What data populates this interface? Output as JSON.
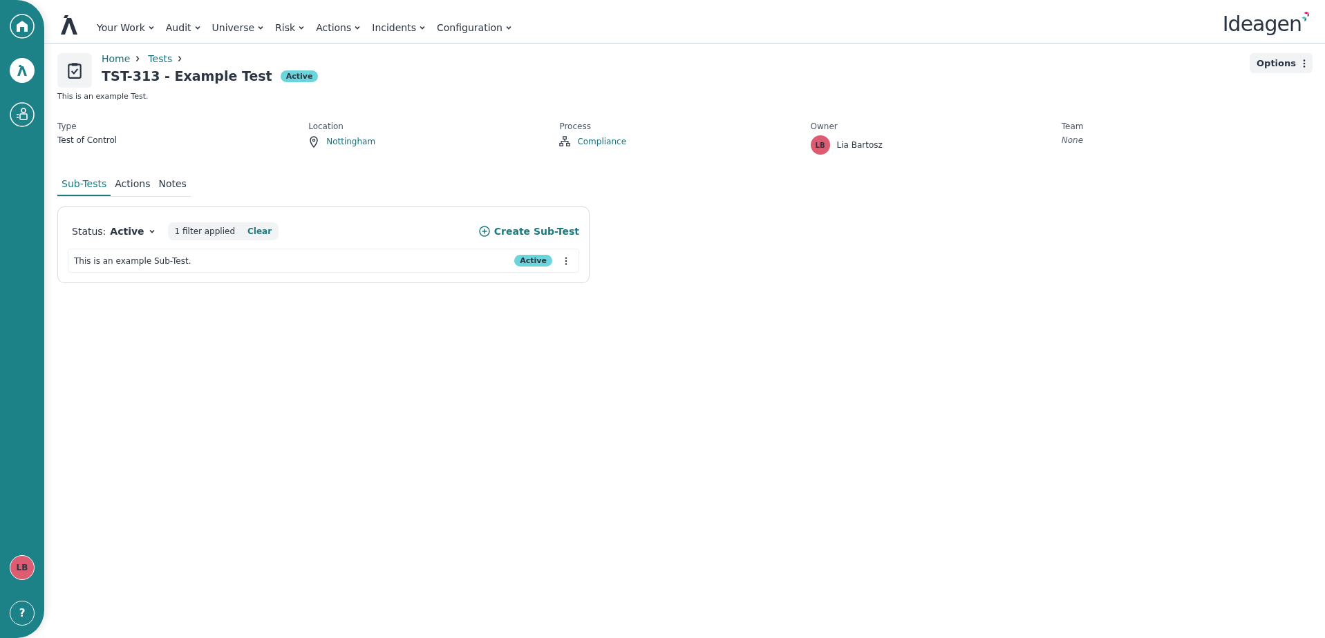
{
  "sidebar": {
    "user_initials": "LB",
    "help_label": "?"
  },
  "nav": {
    "items": [
      {
        "label": "Your Work"
      },
      {
        "label": "Audit"
      },
      {
        "label": "Universe"
      },
      {
        "label": "Risk"
      },
      {
        "label": "Actions"
      },
      {
        "label": "Incidents"
      },
      {
        "label": "Configuration"
      }
    ],
    "brand": "Ideagen"
  },
  "breadcrumb": [
    "Home",
    "Tests"
  ],
  "header": {
    "title": "TST-313 - Example Test",
    "status": "Active",
    "description": "This is an example Test.",
    "options_label": "Options"
  },
  "fields": [
    {
      "kind": "text",
      "label": "Type",
      "value": "Test of Control"
    },
    {
      "kind": "location",
      "label": "Location",
      "value": "Nottingham"
    },
    {
      "kind": "process",
      "label": "Process",
      "value": "Compliance"
    },
    {
      "kind": "person",
      "label": "Owner",
      "value": "Lia Bartosz",
      "initials": "LB"
    },
    {
      "kind": "empty",
      "label": "Team",
      "value": "None"
    }
  ],
  "tabs": [
    {
      "label": "Sub-Tests",
      "selected": true
    },
    {
      "label": "Actions",
      "selected": false
    },
    {
      "label": "Notes",
      "selected": false
    }
  ],
  "panel": {
    "status_filter": {
      "label": "Status:",
      "value": "Active"
    },
    "filter_summary": "1 filter applied",
    "clear_label": "Clear",
    "create_label": "Create Sub-Test",
    "rows": [
      {
        "text": "This is an example Sub-Test.",
        "status": "Active"
      }
    ]
  }
}
